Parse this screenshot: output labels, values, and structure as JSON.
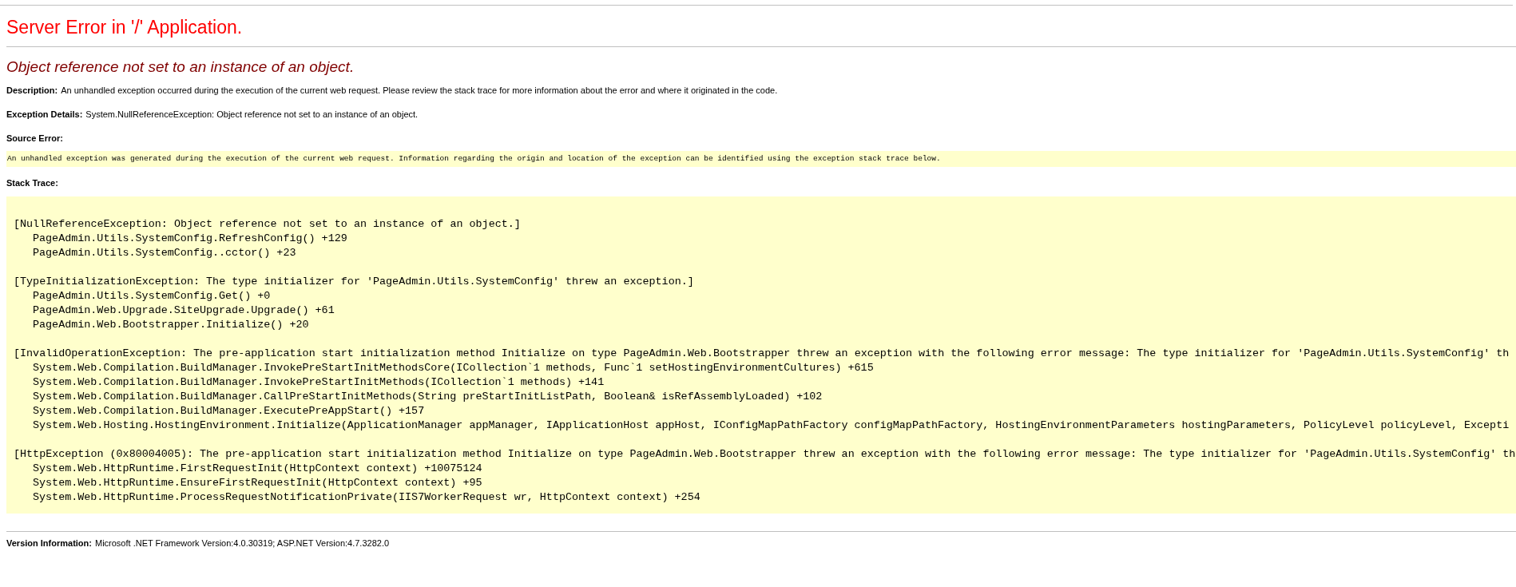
{
  "title": "Server Error in '/' Application.",
  "subtitle": "Object reference not set to an instance of an object.",
  "description": {
    "label": "Description:",
    "text": "An unhandled exception occurred during the execution of the current web request. Please review the stack trace for more information about the error and where it originated in the code."
  },
  "exception_details": {
    "label": "Exception Details:",
    "text": "System.NullReferenceException: Object reference not set to an instance of an object."
  },
  "source_error": {
    "label": "Source Error:",
    "text": "An unhandled exception was generated during the execution of the current web request. Information regarding the origin and location of the exception can be identified using the exception stack trace below."
  },
  "stack_trace": {
    "label": "Stack Trace:",
    "groups": [
      {
        "header": "[NullReferenceException: Object reference not set to an instance of an object.]",
        "frames": [
          "PageAdmin.Utils.SystemConfig.RefreshConfig() +129",
          "PageAdmin.Utils.SystemConfig..cctor() +23"
        ]
      },
      {
        "header": "[TypeInitializationException: The type initializer for 'PageAdmin.Utils.SystemConfig' threw an exception.]",
        "frames": [
          "PageAdmin.Utils.SystemConfig.Get() +0",
          "PageAdmin.Web.Upgrade.SiteUpgrade.Upgrade() +61",
          "PageAdmin.Web.Bootstrapper.Initialize() +20"
        ]
      },
      {
        "header": "[InvalidOperationException: The pre-application start initialization method Initialize on type PageAdmin.Web.Bootstrapper threw an exception with the following error message: The type initializer for 'PageAdmin.Utils.SystemConfig' th",
        "frames": [
          "System.Web.Compilation.BuildManager.InvokePreStartInitMethodsCore(ICollection`1 methods, Func`1 setHostingEnvironmentCultures) +615",
          "System.Web.Compilation.BuildManager.InvokePreStartInitMethods(ICollection`1 methods) +141",
          "System.Web.Compilation.BuildManager.CallPreStartInitMethods(String preStartInitListPath, Boolean& isRefAssemblyLoaded) +102",
          "System.Web.Compilation.BuildManager.ExecutePreAppStart() +157",
          "System.Web.Hosting.HostingEnvironment.Initialize(ApplicationManager appManager, IApplicationHost appHost, IConfigMapPathFactory configMapPathFactory, HostingEnvironmentParameters hostingParameters, PolicyLevel policyLevel, Excepti"
        ]
      },
      {
        "header": "[HttpException (0x80004005): The pre-application start initialization method Initialize on type PageAdmin.Web.Bootstrapper threw an exception with the following error message: The type initializer for 'PageAdmin.Utils.SystemConfig' th",
        "frames": [
          "System.Web.HttpRuntime.FirstRequestInit(HttpContext context) +10075124",
          "System.Web.HttpRuntime.EnsureFirstRequestInit(HttpContext context) +95",
          "System.Web.HttpRuntime.ProcessRequestNotificationPrivate(IIS7WorkerRequest wr, HttpContext context) +254"
        ]
      }
    ]
  },
  "version_info": {
    "label": "Version Information:",
    "text": "Microsoft .NET Framework Version:4.0.30319; ASP.NET Version:4.7.3282.0"
  }
}
